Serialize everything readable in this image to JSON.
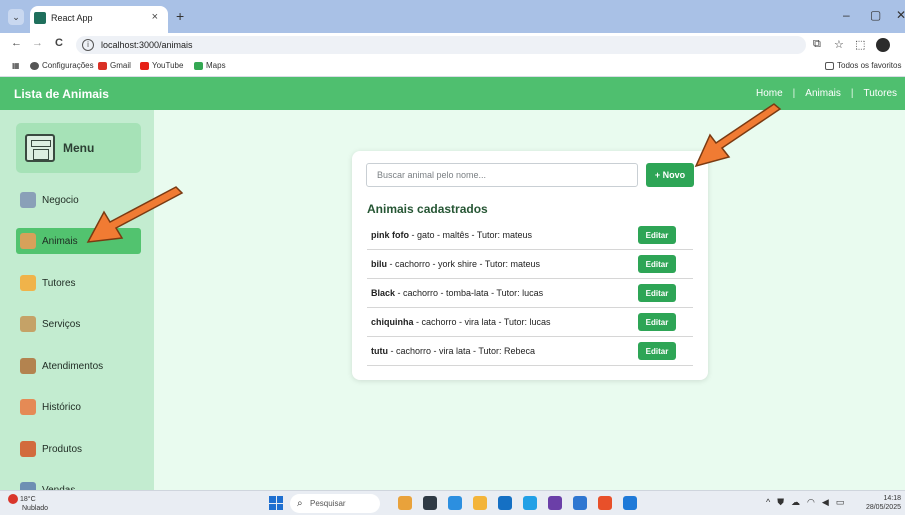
{
  "browser": {
    "tab_title": "React App",
    "tab_close": "×",
    "new_tab": "+",
    "url": "localhost:3000/animais",
    "controls": {
      "minimize": "–",
      "maximize": "▢",
      "close": "✕"
    },
    "nav": {
      "back": "←",
      "forward": "→",
      "reload": "C"
    },
    "bookmarks": [
      {
        "label": "Configurações",
        "color": "#555555"
      },
      {
        "label": "Gmail",
        "color": "#d93025"
      },
      {
        "label": "YouTube",
        "color": "#e62117"
      },
      {
        "label": "Maps",
        "color": "#34a853"
      }
    ],
    "all_bookmarks": "Todos os favoritos"
  },
  "app": {
    "title": "Lista de Animais",
    "topnav": [
      "Home",
      "|",
      "Animais",
      "|",
      "Tutores"
    ],
    "sidebar": {
      "menu_label": "Menu",
      "items": [
        {
          "label": "Negocio",
          "icon": "business-icon",
          "color": "#8aa0b8",
          "active": false
        },
        {
          "label": "Animais",
          "icon": "tent-icon",
          "color": "#d7a15a",
          "active": true
        },
        {
          "label": "Tutores",
          "icon": "tutor-icon",
          "color": "#f0b34a",
          "active": false
        },
        {
          "label": "Serviços",
          "icon": "services-icon",
          "color": "#c5a267",
          "active": false
        },
        {
          "label": "Atendimentos",
          "icon": "clipboard-icon",
          "color": "#b3834f",
          "active": false
        },
        {
          "label": "Histórico",
          "icon": "calendar-icon",
          "color": "#e58a55",
          "active": false
        },
        {
          "label": "Produtos",
          "icon": "store-icon",
          "color": "#d26b3d",
          "active": false
        },
        {
          "label": "Vendas",
          "icon": "sales-icon",
          "color": "#6d8fb3",
          "active": false
        }
      ]
    },
    "search": {
      "placeholder": "Buscar animal pelo nome...",
      "value": ""
    },
    "new_button": "+ Novo",
    "list_title": "Animais cadastrados",
    "edit_label": "Editar",
    "animals": [
      {
        "name": "pink fofo",
        "details": " - gato - maltês - Tutor: mateus"
      },
      {
        "name": "bilu",
        "details": " - cachorro - york shire - Tutor: mateus"
      },
      {
        "name": "Black",
        "details": " - cachorro - tomba-lata - Tutor: lucas"
      },
      {
        "name": "chiquinha",
        "details": " - cachorro - vira lata - Tutor: lucas"
      },
      {
        "name": "tutu",
        "details": " - cachorro - vira lata - Tutor: Rebeca"
      }
    ],
    "accent_color": "#4fbf6f",
    "button_color": "#2ea556",
    "arrow_color": "#f07b33"
  },
  "taskbar": {
    "temperature": "18°C",
    "weather": "Nublado",
    "search_label": "Pesquisar",
    "apps": [
      "#e9a23b",
      "#2f3a45",
      "#2c8fe0",
      "#f3b43a",
      "#1570c4",
      "#22a0e6",
      "#6b3fa8",
      "#2f77d1",
      "#e8502a",
      "#1f7ad8"
    ],
    "time": "14:18",
    "date": "28/05/2025"
  }
}
